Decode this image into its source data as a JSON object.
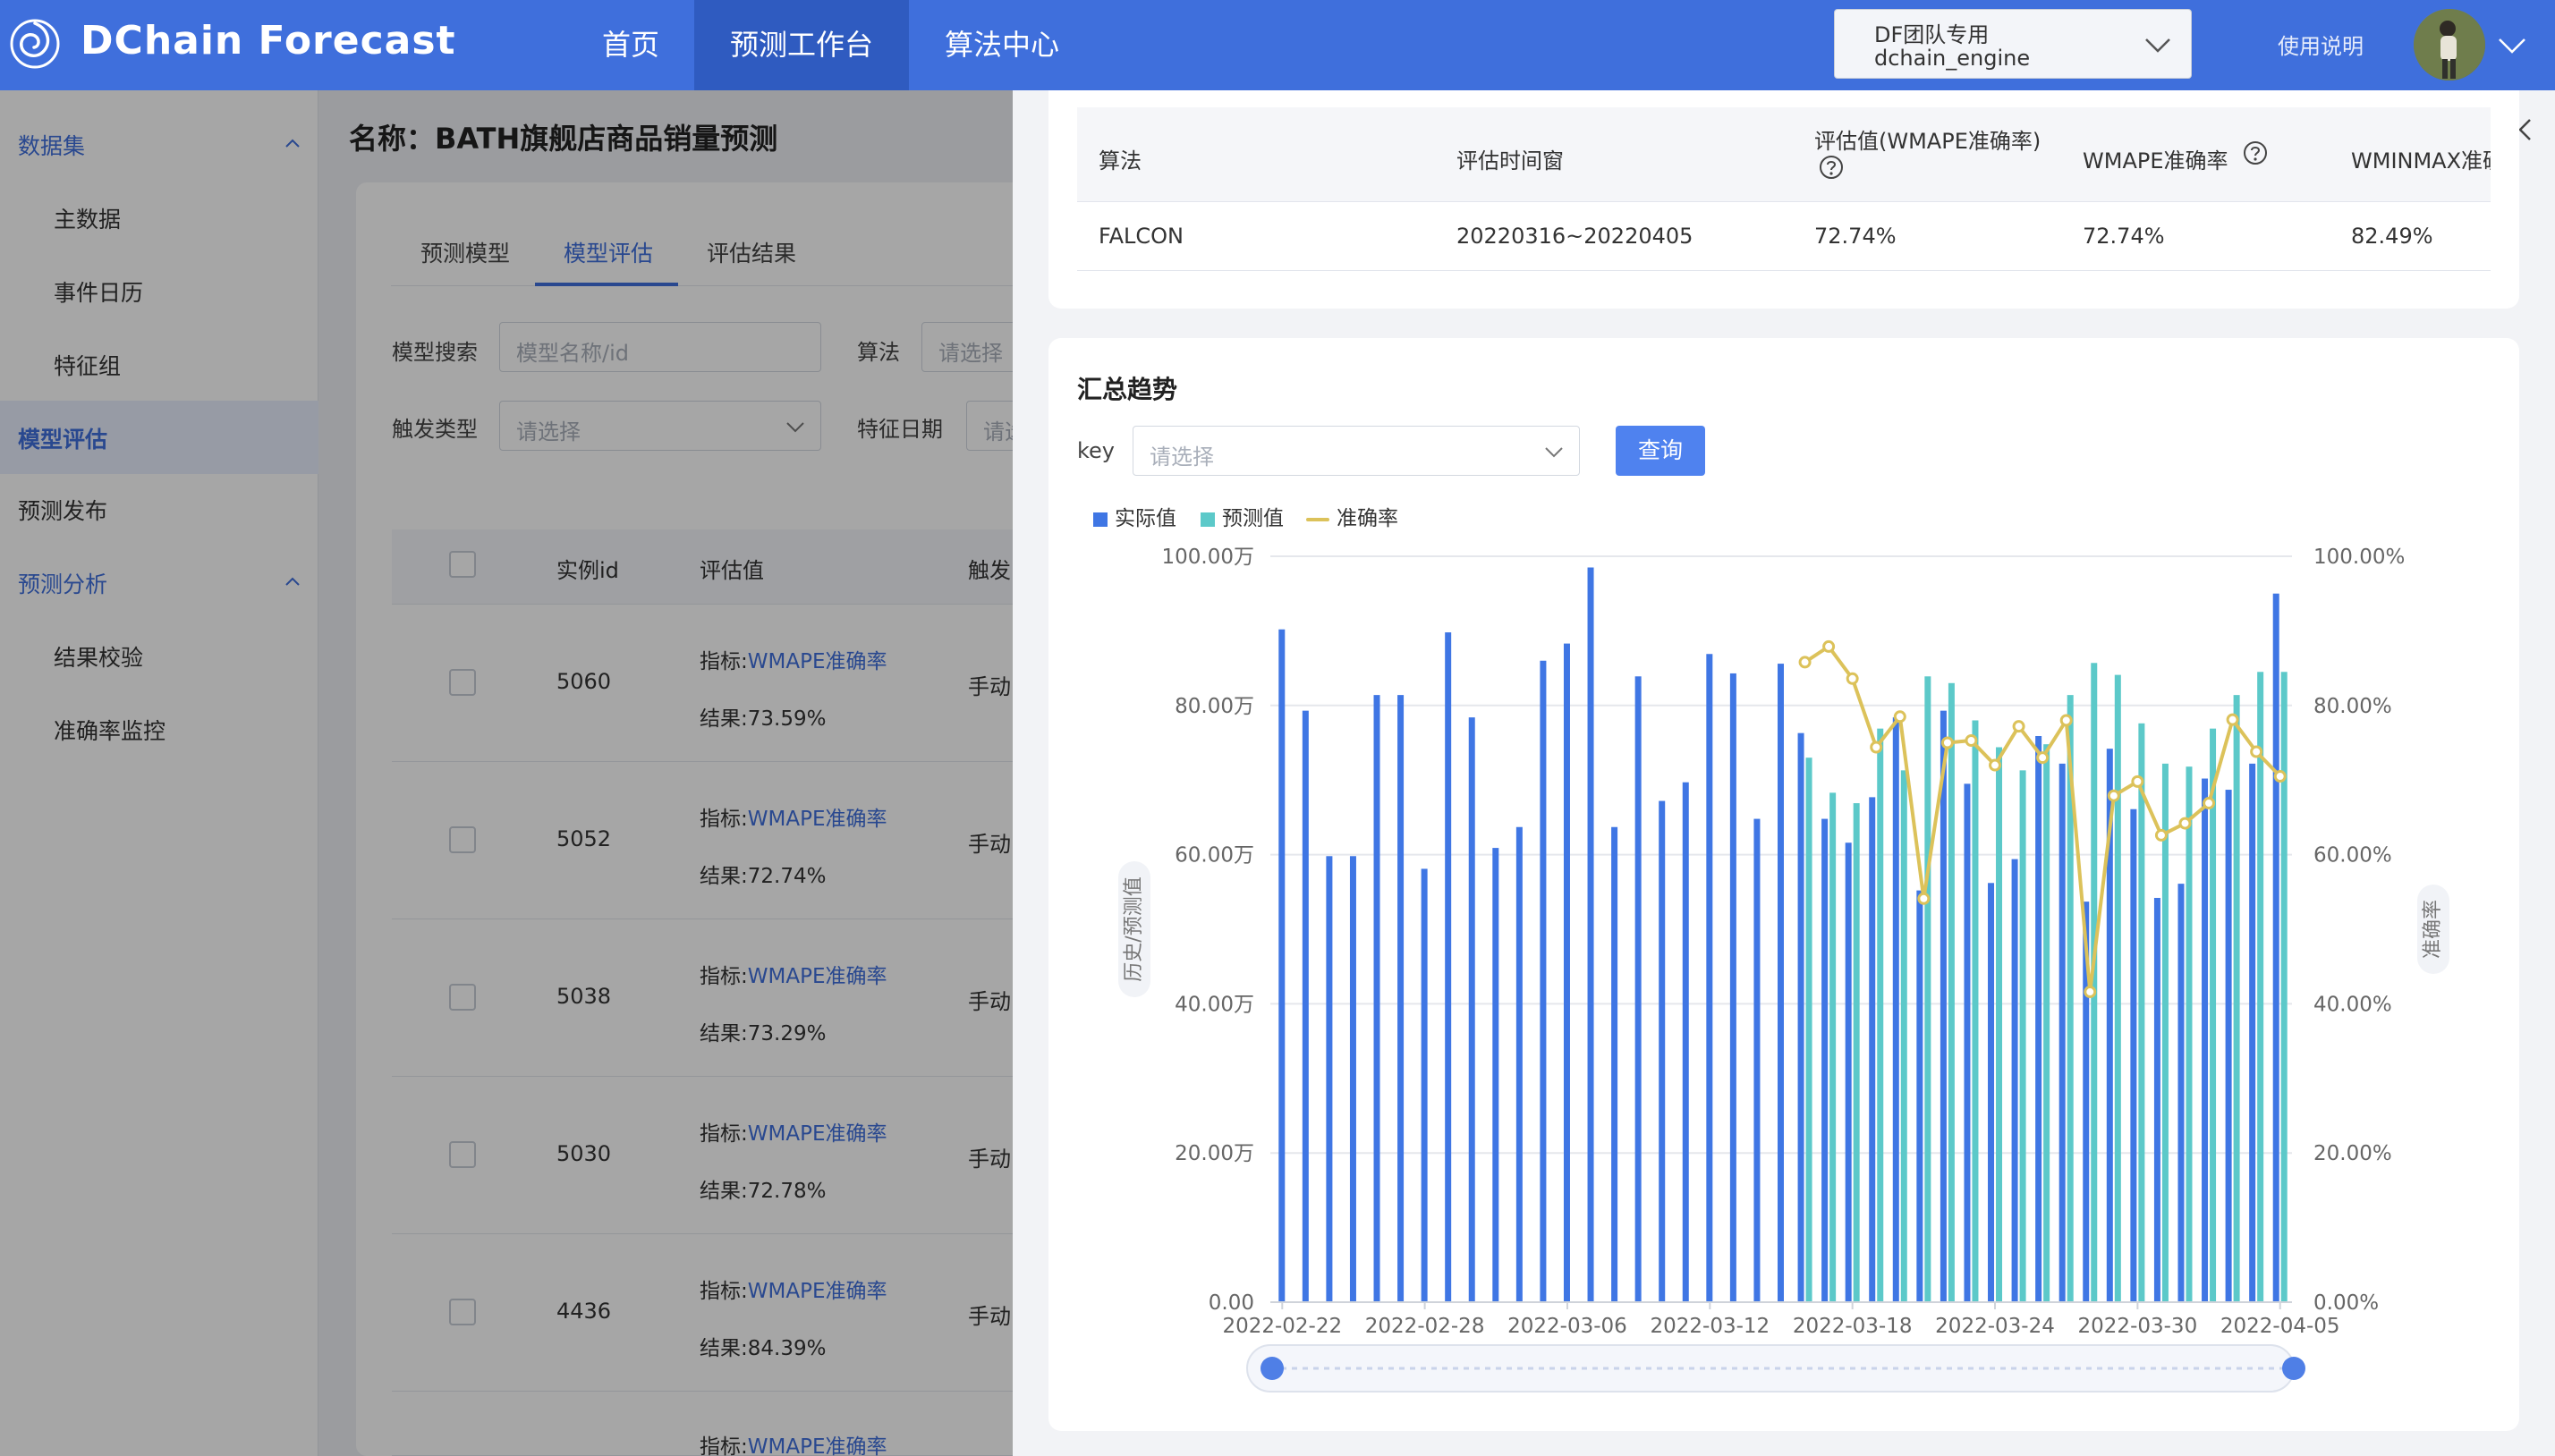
{
  "app": {
    "title": "DChain Forecast",
    "nav": [
      {
        "label": "首页",
        "active": false
      },
      {
        "label": "预测工作台",
        "active": true
      },
      {
        "label": "算法中心",
        "active": false
      }
    ],
    "tenant": {
      "line1": "DF团队专用",
      "line2": "dchain_engine"
    },
    "help": "使用说明",
    "colors": {
      "primary": "#3f6fdc",
      "actual": "#3f76e4",
      "predicted": "#5cc9c9",
      "accuracy": "#dcc25a"
    }
  },
  "sidebar": {
    "groups": [
      {
        "label": "数据集",
        "items": [
          "主数据",
          "事件日历",
          "特征组"
        ]
      },
      {
        "label": "模型评估",
        "active": true
      },
      {
        "label": "预测发布"
      },
      {
        "label": "预测分析",
        "items": [
          "结果校验",
          "准确率监控"
        ]
      }
    ]
  },
  "main": {
    "title": "名称：BATH旗舰店商品销量预测",
    "tabs": [
      "预测模型",
      "模型评估",
      "评估结果"
    ],
    "filters": {
      "model_search_label": "模型搜索",
      "model_search_placeholder": "模型名称/id",
      "algo_label": "算法",
      "algo_placeholder": "请选择",
      "trigger_label": "触发类型",
      "trigger_placeholder": "请选择",
      "feature_date_label": "特征日期",
      "feature_date_placeholder": "请选"
    },
    "table": {
      "headers": [
        "实例id",
        "评估值",
        "触发"
      ],
      "rows": [
        {
          "id": "5060",
          "metric_prefix": "指标:",
          "metric": "WMAPE准确率",
          "result": "结果:73.59%",
          "trigger": "手动"
        },
        {
          "id": "5052",
          "metric_prefix": "指标:",
          "metric": "WMAPE准确率",
          "result": "结果:72.74%",
          "trigger": "手动"
        },
        {
          "id": "5038",
          "metric_prefix": "指标:",
          "metric": "WMAPE准确率",
          "result": "结果:73.29%",
          "trigger": "手动"
        },
        {
          "id": "5030",
          "metric_prefix": "指标:",
          "metric": "WMAPE准确率",
          "result": "结果:72.78%",
          "trigger": "手动"
        },
        {
          "id": "4436",
          "metric_prefix": "指标:",
          "metric": "WMAPE准确率",
          "result": "结果:84.39%",
          "trigger": "手动"
        },
        {
          "id": "",
          "metric_prefix": "指标:",
          "metric": "WMAPE准确率",
          "result": "",
          "trigger": ""
        }
      ]
    }
  },
  "drawer": {
    "eval_table": {
      "headers": [
        "算法",
        "评估时间窗",
        "评估值(WMAPE准确率)",
        "WMAPE准确率",
        "WMINMAX准确"
      ],
      "row": [
        "FALCON",
        "20220316~20220405",
        "72.74%",
        "72.74%",
        "82.49%"
      ]
    },
    "trend": {
      "title": "汇总趋势",
      "key_label": "key",
      "key_placeholder": "请选择",
      "query_button": "查询",
      "legend": [
        "实际值",
        "预测值",
        "准确率"
      ]
    }
  },
  "chart_data": {
    "type": "bar",
    "left_axis_title": "历史/预测值",
    "right_axis_title": "准确率",
    "left_ticks": [
      "0.00",
      "20.00万",
      "40.00万",
      "60.00万",
      "80.00万",
      "100.00万"
    ],
    "right_ticks": [
      "0.00%",
      "20.00%",
      "40.00%",
      "60.00%",
      "80.00%",
      "100.00%"
    ],
    "ylim_left": [
      0,
      100
    ],
    "ylim_right": [
      0,
      100
    ],
    "x_tick_labels": [
      "2022-02-22",
      "2022-02-28",
      "2022-03-06",
      "2022-03-12",
      "2022-03-18",
      "2022-03-24",
      "2022-03-30",
      "2022-04-05"
    ],
    "x": [
      "2022-02-22",
      "2022-02-23",
      "2022-02-24",
      "2022-02-25",
      "2022-02-26",
      "2022-02-27",
      "2022-02-28",
      "2022-03-01",
      "2022-03-02",
      "2022-03-03",
      "2022-03-04",
      "2022-03-05",
      "2022-03-06",
      "2022-03-07",
      "2022-03-08",
      "2022-03-09",
      "2022-03-10",
      "2022-03-11",
      "2022-03-12",
      "2022-03-13",
      "2022-03-14",
      "2022-03-15",
      "2022-03-16",
      "2022-03-17",
      "2022-03-18",
      "2022-03-19",
      "2022-03-20",
      "2022-03-21",
      "2022-03-22",
      "2022-03-23",
      "2022-03-24",
      "2022-03-25",
      "2022-03-26",
      "2022-03-27",
      "2022-03-28",
      "2022-03-29",
      "2022-03-30",
      "2022-03-31",
      "2022-04-01",
      "2022-04-02",
      "2022-04-03",
      "2022-04-04",
      "2022-04-05"
    ],
    "series": [
      {
        "name": "实际值",
        "unit": "万",
        "values": [
          90.2,
          79.3,
          59.8,
          59.8,
          81.4,
          81.4,
          58.1,
          89.8,
          78.4,
          60.9,
          63.7,
          86.0,
          88.3,
          98.5,
          63.7,
          83.9,
          67.2,
          69.7,
          86.9,
          84.3,
          64.8,
          85.6,
          76.3,
          64.8,
          61.6,
          67.7,
          78.4,
          55.2,
          79.3,
          69.5,
          56.2,
          59.4,
          75.9,
          72.2,
          53.7,
          74.2,
          66.1,
          54.2,
          56.1,
          70.2,
          68.7,
          72.2,
          95.0
        ]
      },
      {
        "name": "预测值",
        "unit": "万",
        "values": [
          null,
          null,
          null,
          null,
          null,
          null,
          null,
          null,
          null,
          null,
          null,
          null,
          null,
          null,
          null,
          null,
          null,
          null,
          null,
          null,
          null,
          null,
          73.0,
          68.3,
          66.9,
          76.9,
          71.3,
          83.9,
          83.0,
          78.0,
          74.4,
          71.3,
          74.8,
          81.4,
          85.7,
          84.1,
          77.6,
          72.2,
          71.8,
          76.9,
          81.4,
          84.5,
          84.5
        ]
      },
      {
        "name": "准确率",
        "unit": "%",
        "values": [
          null,
          null,
          null,
          null,
          null,
          null,
          null,
          null,
          null,
          null,
          null,
          null,
          null,
          null,
          null,
          null,
          null,
          null,
          null,
          null,
          null,
          null,
          85.8,
          87.9,
          83.6,
          74.4,
          78.5,
          54.1,
          75.0,
          75.3,
          72.0,
          77.2,
          73.0,
          78.0,
          41.6,
          67.9,
          69.8,
          62.6,
          64.2,
          66.9,
          78.1,
          73.8,
          70.5
        ]
      }
    ]
  }
}
